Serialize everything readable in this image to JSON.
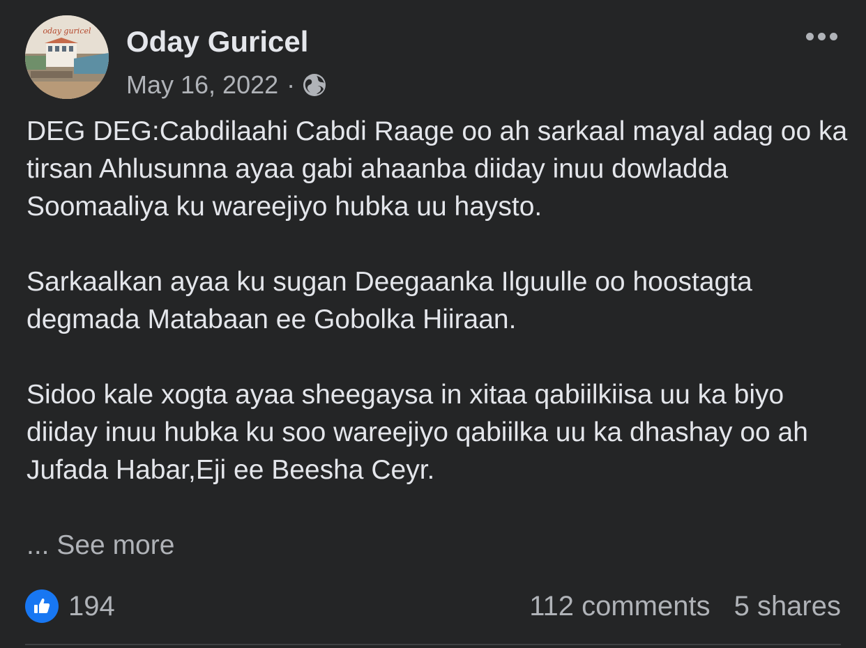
{
  "post": {
    "author": "Oday Guricel",
    "avatar_text": "oday guricel",
    "date": "May 16, 2022",
    "separator": "·",
    "privacy_icon": "globe-icon",
    "more_icon": "ellipsis-icon",
    "paragraphs": [
      "DEG DEG:Cabdilaahi Cabdi Raage oo ah sarkaal mayal adag oo ka tirsan Ahlusunna ayaa gabi ahaanba diiday inuu dowladda Soomaaliya ku wareejiyo hubka uu haysto.",
      "Sarkaalkan ayaa ku sugan Deegaanka Ilguulle oo hoostagta degmada Matabaan ee Gobolka Hiiraan.",
      "Sidoo kale xogta ayaa sheegaysa in xitaa qabiilkiisa uu ka biyo diiday inuu hubka ku soo wareejiyo qabiilka uu ka dhashay oo ah Jufada Habar,Eji ee Beesha Ceyr."
    ],
    "see_more": "... See more"
  },
  "stats": {
    "like_icon": "thumbs-up-icon",
    "likes": "194",
    "comments": "112 comments",
    "shares": "5 shares"
  },
  "colors": {
    "background": "#242526",
    "primary_text": "#e4e6eb",
    "secondary_text": "#b0b3b8",
    "like_blue": "#1877f2"
  }
}
